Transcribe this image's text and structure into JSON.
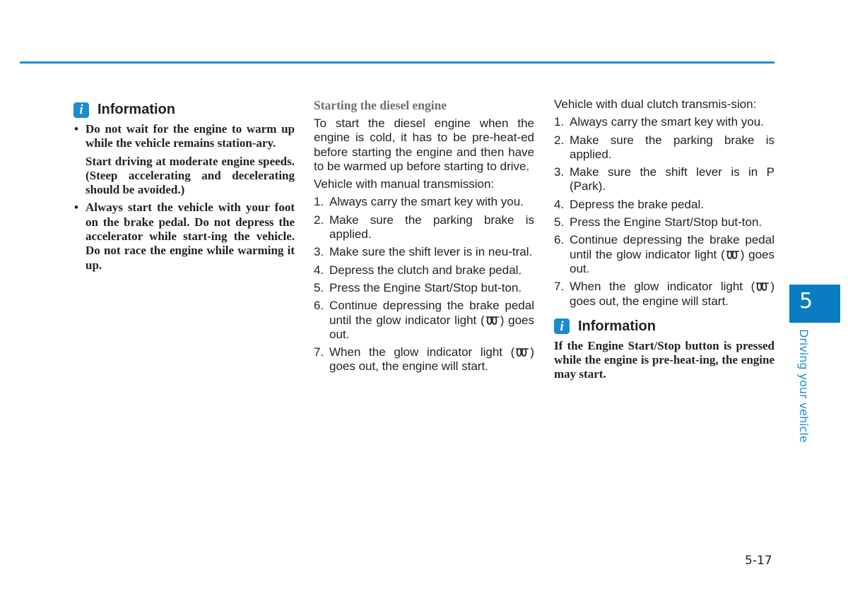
{
  "page": {
    "page_number": "5-17",
    "chapter_number": "5",
    "chapter_title": "Driving your vehicle",
    "accent_color": "#1a8bd0"
  },
  "left_column": {
    "info_title": "Information",
    "info_icon": "info-icon",
    "bullets": [
      {
        "paragraphs": [
          "Do not wait for the engine to warm up while the vehicle remains station-ary.",
          "Start driving at moderate engine speeds. (Steep accelerating and decelerating should be avoided.)"
        ]
      },
      {
        "paragraphs": [
          "Always start the vehicle with your foot on the brake pedal. Do not depress the accelerator while start-ing the vehicle. Do not race the engine while warming it up."
        ]
      }
    ]
  },
  "middle_column": {
    "heading": "Starting the diesel engine",
    "intro": "To start the diesel engine when the engine is cold, it has to be pre-heat-ed before starting the engine and then have to be warmed up before starting to drive.",
    "subheading": "Vehicle with manual transmission:",
    "steps": [
      {
        "num": "1.",
        "text": "Always carry the smart key with you."
      },
      {
        "num": "2.",
        "text": "Make sure the parking brake is applied."
      },
      {
        "num": "3.",
        "text": "Make sure the shift lever is in neu-tral."
      },
      {
        "num": "4.",
        "text": "Depress the clutch and brake pedal."
      },
      {
        "num": "5.",
        "text": "Press the Engine Start/Stop but-ton."
      },
      {
        "num": "6.",
        "text_before": "Continue depressing the brake pedal until the glow indicator light (",
        "text_after": ") goes out."
      },
      {
        "num": "7.",
        "text_before": "When the glow indicator light (",
        "text_after": ") goes out, the engine will start."
      }
    ]
  },
  "right_column": {
    "subheading": "Vehicle with dual clutch transmis-sion:",
    "steps": [
      {
        "num": "1.",
        "text": "Always carry the smart key with you."
      },
      {
        "num": "2.",
        "text": "Make sure the parking brake is applied."
      },
      {
        "num": "3.",
        "text": "Make sure the shift lever is in P (Park)."
      },
      {
        "num": "4.",
        "text": "Depress the brake pedal."
      },
      {
        "num": "5.",
        "text": "Press the Engine Start/Stop but-ton."
      },
      {
        "num": "6.",
        "text_before": "Continue depressing the brake pedal until the glow indicator light (",
        "text_after": ") goes out."
      },
      {
        "num": "7.",
        "text_before": "When the glow indicator light (",
        "text_after": ") goes out, the engine will start."
      }
    ],
    "info_title": "Information",
    "info_text": "If the Engine Start/Stop button is pressed while the engine is pre-heat-ing, the engine may start."
  }
}
